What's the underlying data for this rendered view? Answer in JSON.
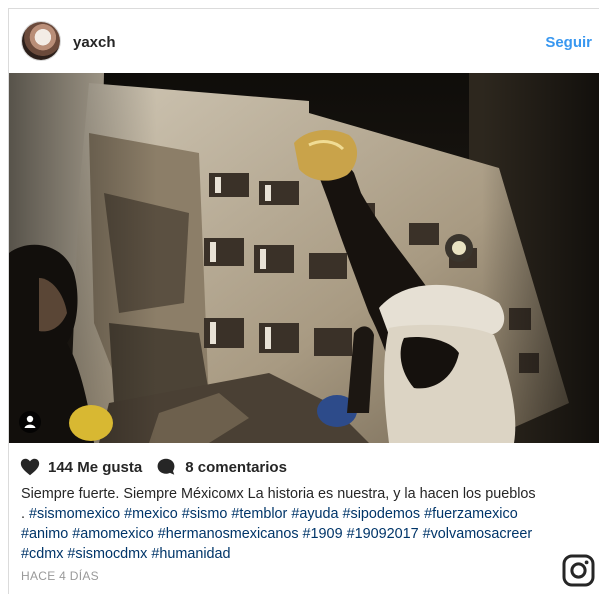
{
  "header": {
    "username": "yaxch",
    "follow_label": "Seguir"
  },
  "post": {
    "likes_label": "144 Me gusta",
    "comments_label": "8 comentarios",
    "caption_text": "Siempre fuerte. Siempre Méxicoмx La historia es nuestra, y la hacen los pueblos .",
    "caption_hashtags": "#sismomexico #mexico #sismo #temblor #ayuda #sipodemos #fuerzamexico #animo #amomexico #hermanosmexicanos #1909 #19092017 #volvamosacreer #cdmx #sismocdmx #humanidad",
    "timestamp": "HACE 4 DÍAS"
  },
  "icons": {
    "avatar": "profile-avatar",
    "user_tag": "user-tag-icon",
    "like": "heart-icon",
    "comment": "comment-bubble-icon",
    "brand": "instagram-icon"
  },
  "colors": {
    "link": "#3897f0",
    "hashtag": "#003569",
    "muted": "#999999"
  }
}
